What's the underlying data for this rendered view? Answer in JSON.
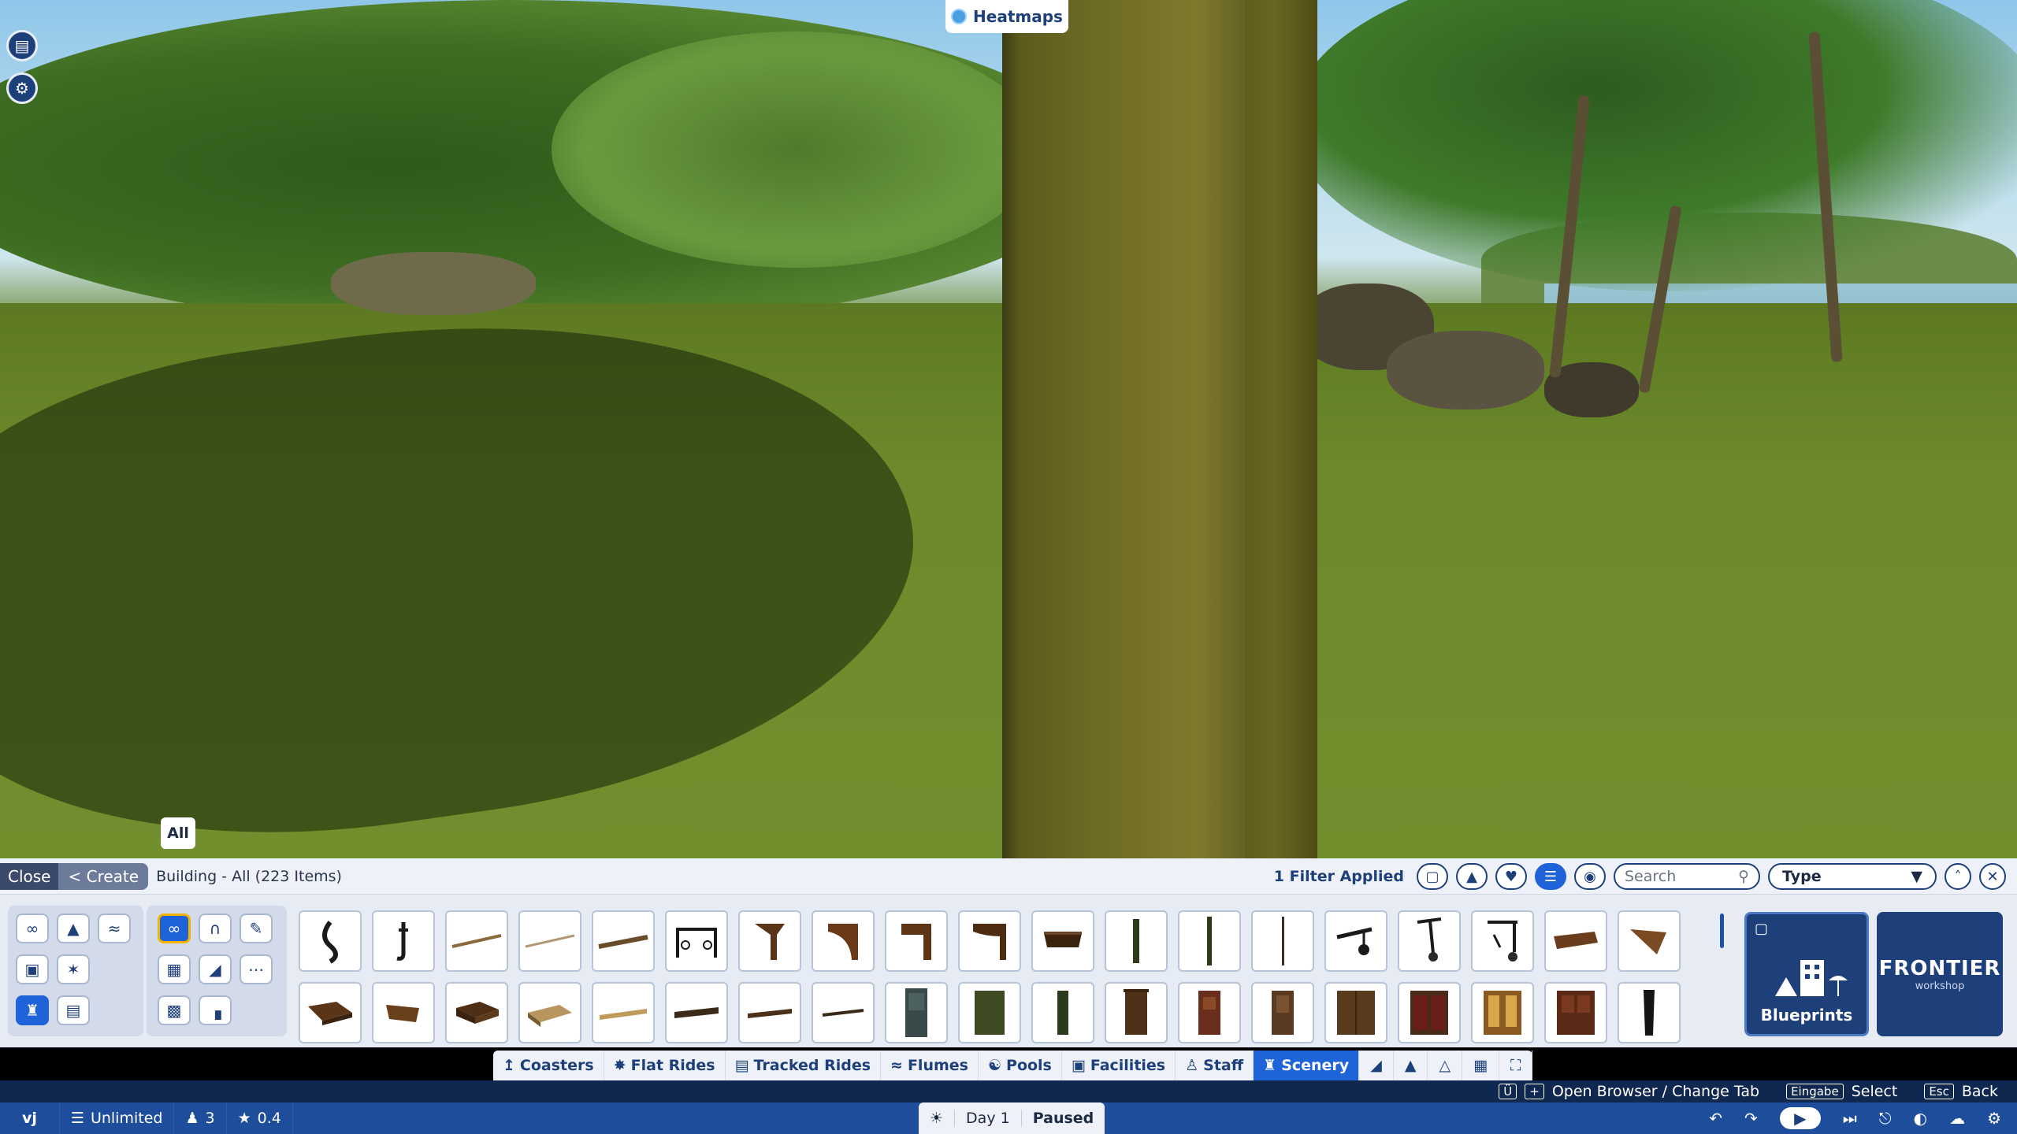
{
  "hud": {
    "heatmaps_label": "Heatmaps",
    "all_tag": "All"
  },
  "panel": {
    "close_label": "Close",
    "create_label": "< Create",
    "title": "Building - All (223 Items)",
    "filter_text": "1 Filter Applied",
    "search_placeholder": "Search",
    "type_label": "Type"
  },
  "blueprints_label": "Blueprints",
  "frontier": {
    "brand": "FRONTIER",
    "sub": "workshop"
  },
  "tabs": [
    "Coasters",
    "Flat Rides",
    "Tracked Rides",
    "Flumes",
    "Pools",
    "Facilities",
    "Staff",
    "Scenery"
  ],
  "active_tab": "Scenery",
  "hints": {
    "browse_keys": [
      "Ü",
      "+"
    ],
    "browse_label": "Open Browser / Change Tab",
    "select_key": "Eingabe",
    "select_label": "Select",
    "back_key": "Esc",
    "back_label": "Back"
  },
  "status": {
    "user": "vj",
    "money": "Unlimited",
    "guests": "3",
    "rating": "0.4",
    "day": "Day 1",
    "state": "Paused"
  },
  "colors": {
    "accent": "#1f63d8",
    "dark_blue": "#1d3f7a",
    "status_bar": "#1e4d9c",
    "selected_outline": "#f2b300"
  },
  "items": {
    "row1": [
      "chain-link",
      "hook",
      "thin-rod",
      "thin-rod-light",
      "plank-rod",
      "gate-frame",
      "bracket-1",
      "bracket-2",
      "bracket-3",
      "bracket-4",
      "shelf-box",
      "post-slim",
      "post-tall",
      "pole-thin",
      "lamp-arm",
      "hanging-lamp",
      "hanging-lamp-2",
      "flat-board",
      "wedge-board"
    ],
    "row2": [
      "crate-flat",
      "wedge-block",
      "crate-box",
      "tray",
      "long-plank",
      "shelf-dark",
      "beam",
      "beam-thin",
      "door-grey",
      "panel-green",
      "post-block",
      "door-wood",
      "door-red",
      "door-brown",
      "double-door",
      "double-door-red",
      "window-door",
      "cabinet",
      "dark-post"
    ]
  }
}
